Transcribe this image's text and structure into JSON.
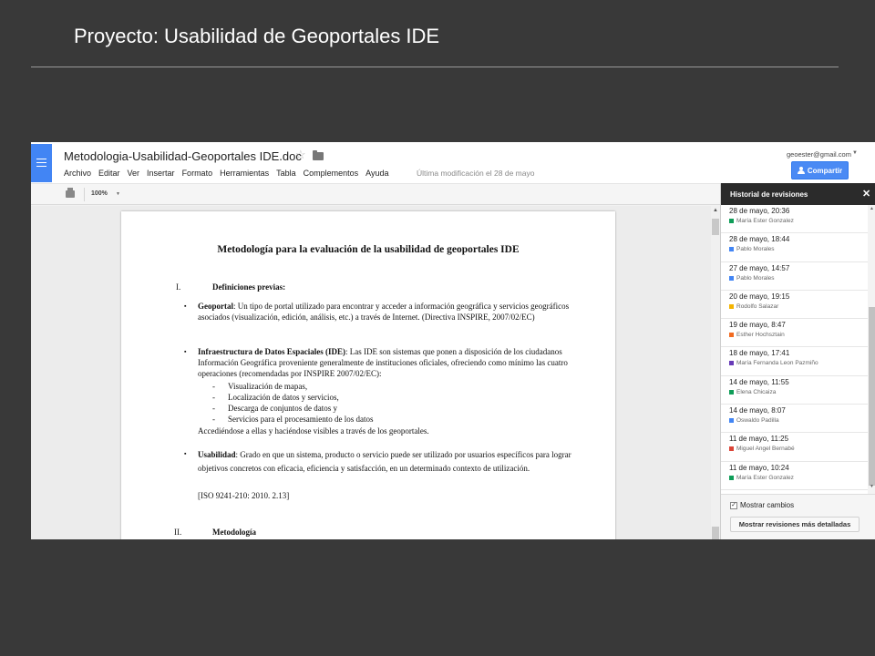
{
  "slide": {
    "title": "Proyecto: Usabilidad de Geoportales IDE"
  },
  "app": {
    "doc_title": "Metodologia-Usabilidad-Geoportales IDE.doc",
    "menu": [
      "Archivo",
      "Editar",
      "Ver",
      "Insertar",
      "Formato",
      "Herramientas",
      "Tabla",
      "Complementos",
      "Ayuda"
    ],
    "last_modified": "Última modificación el 28 de mayo",
    "account_email": "geoester@gmail.com",
    "share_label": "Compartir",
    "zoom": "100%"
  },
  "document": {
    "heading": "Metodología para la evaluación de la usabilidad de geoportales IDE",
    "section1": {
      "num": "I.",
      "title": "Definiciones previas:"
    },
    "geoportal": {
      "term": "Geoportal",
      "text": ": Un tipo de portal utilizado para encontrar y acceder a información geográfica y servicios geográficos asociados (visualización, edición, análisis, etc.) a través de Internet. (Directiva INSPIRE, 2007/02/EC)"
    },
    "ide": {
      "term": "Infraestructura de Datos Espaciales (IDE)",
      "text": ": Las IDE son sistemas que ponen a disposición de los ciudadanos Información Geográfica proveniente generalmente de instituciones oficiales, ofreciendo como mínimo las cuatro operaciones (recomendadas por INSPIRE 2007/02/EC):",
      "items": [
        "Visualización de mapas,",
        "Localización de datos y servicios,",
        "Descarga de conjuntos de datos y",
        "Servicios para el procesamiento de los datos"
      ],
      "closing": "Accediéndose a ellas y haciéndose visibles a través de los geoportales."
    },
    "usabilidad": {
      "term": "Usabilidad",
      "text": ": Grado en que un sistema, producto o servicio puede ser utilizado por usuarios específicos para lograr objetivos concretos con eficacia, eficiencia y satisfacción, en un determinado contexto de utilización.",
      "ref": "[ISO 9241-210: 2010. 2.13]"
    },
    "section2": {
      "num": "II.",
      "title": "Metodología"
    }
  },
  "revisions": {
    "title": "Historial de revisiones",
    "items": [
      {
        "date": "28 de mayo, 20:36",
        "author": "María Ester Gonzalez",
        "color": "#0f9d58"
      },
      {
        "date": "28 de mayo, 18:44",
        "author": "Pablo Morales",
        "color": "#4285f4"
      },
      {
        "date": "27 de mayo, 14:57",
        "author": "Pablo Morales",
        "color": "#4285f4"
      },
      {
        "date": "20 de mayo, 19:15",
        "author": "Rodolfo Salazar",
        "color": "#f4b400"
      },
      {
        "date": "19 de mayo, 8:47",
        "author": "Esther Hochsztain",
        "color": "#f26b21"
      },
      {
        "date": "18 de mayo, 17:41",
        "author": "María Fernanda Leon Pazmiño",
        "color": "#673ab7"
      },
      {
        "date": "14 de mayo, 11:55",
        "author": "Elena Chicaiza",
        "color": "#0f9d58"
      },
      {
        "date": "14 de mayo, 8:07",
        "author": "Oswaldo Padilla",
        "color": "#4285f4"
      },
      {
        "date": "11 de mayo, 11:25",
        "author": "Miguel Angel Bernabé",
        "color": "#db4437"
      },
      {
        "date": "11 de mayo, 10:24",
        "author": "María Ester Gonzalez",
        "color": "#0f9d58"
      }
    ],
    "show_changes": "Mostrar cambios",
    "detail_button": "Mostrar revisiones más detalladas"
  }
}
